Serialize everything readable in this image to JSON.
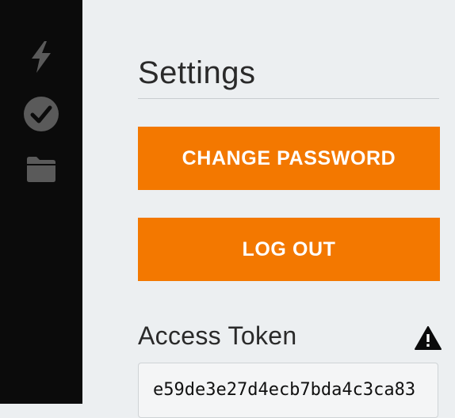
{
  "sidebar": {
    "items": [
      {
        "icon": "lightning-icon"
      },
      {
        "icon": "check-circle-icon"
      },
      {
        "icon": "folder-icon"
      }
    ],
    "icon_color": "#5a5a5a"
  },
  "settings": {
    "title": "Settings",
    "change_password_label": "CHANGE PASSWORD",
    "logout_label": "LOG OUT",
    "access_token_label": "Access Token",
    "access_token_value": "e59de3e27d4ecb7bda4c3ca83"
  },
  "colors": {
    "accent": "#f37800",
    "sidebar_bg": "#0b0b0b",
    "page_bg": "#eceff1"
  }
}
